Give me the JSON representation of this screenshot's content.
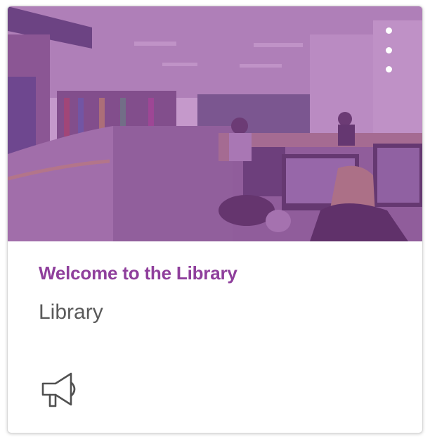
{
  "card": {
    "title": "Welcome to the Library",
    "subtitle": "Library",
    "image_icon": "library-photo",
    "menu_icon": "vertical-ellipsis-icon",
    "announcement_icon": "megaphone-icon",
    "accent_color": "#8f3f9c"
  }
}
